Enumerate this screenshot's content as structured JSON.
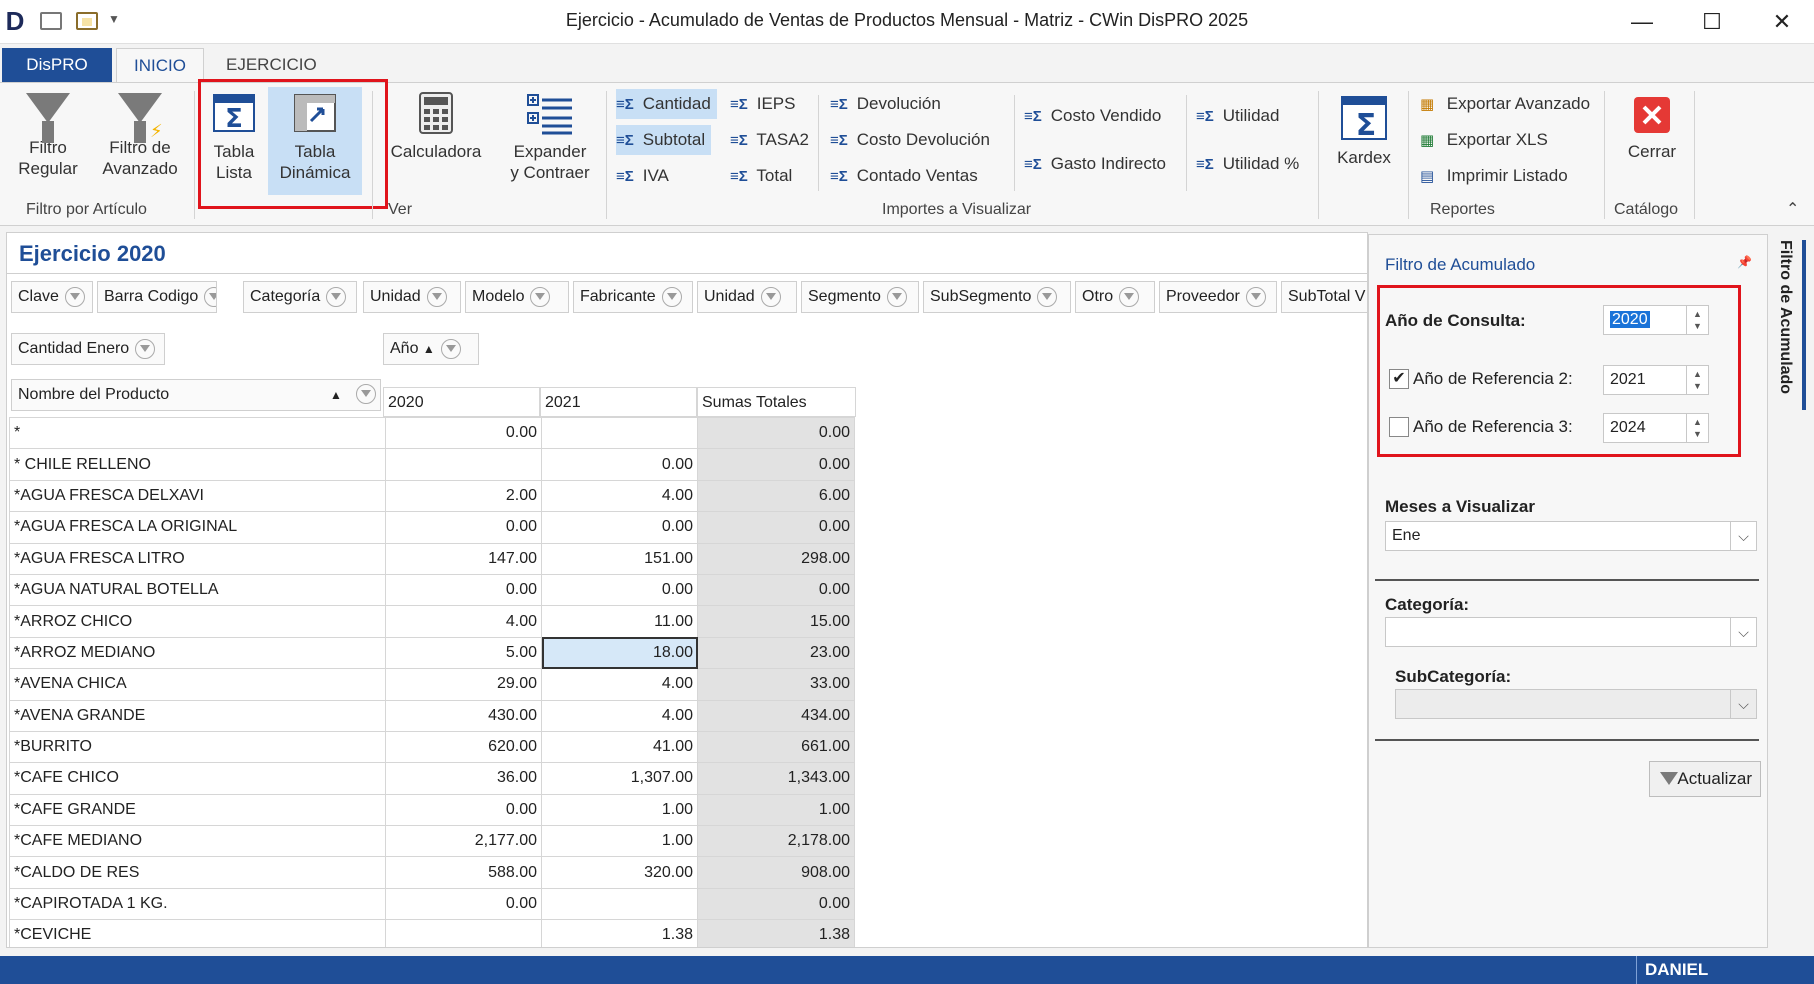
{
  "window": {
    "title": "Ejercicio - Acumulado de Ventas de Productos Mensual - Matriz - CWin DisPRO 2025",
    "logo": "D",
    "min": "—",
    "max": "☐",
    "close": "✕"
  },
  "tabs": [
    "DisPRO",
    "INICIO",
    "EJERCICIO"
  ],
  "ribbon": {
    "filtro_regular": [
      "Filtro",
      "Regular"
    ],
    "filtro_avanzado": [
      "Filtro de",
      "Avanzado"
    ],
    "group_filtro": "Filtro por Artículo",
    "tabla_lista": [
      "Tabla",
      "Lista"
    ],
    "tabla_dinamica": [
      "Tabla",
      "Dinámica"
    ],
    "calculadora": "Calculadora",
    "expander": [
      "Expander",
      "y Contraer"
    ],
    "group_ver": "Ver",
    "importes": {
      "col1": [
        "Cantidad",
        "Subtotal",
        "IVA"
      ],
      "col2": [
        "IEPS",
        "TASA2",
        "Total"
      ],
      "col3": [
        "Devolución",
        "Costo Devolución",
        "Contado Ventas"
      ],
      "col4": [
        "Costo Vendido",
        "Gasto Indirecto"
      ],
      "col5": [
        "Utilidad",
        "Utilidad %"
      ]
    },
    "group_importes": "Importes a Visualizar",
    "kardex": "Kardex",
    "reportes": [
      "Exportar Avanzado",
      "Exportar XLS",
      "Imprimir Listado"
    ],
    "group_reportes": "Reportes",
    "cerrar": "Cerrar",
    "group_catalogo": "Catálogo"
  },
  "main": {
    "title": "Ejercicio 2020",
    "fields": [
      "Clave",
      "Barra Codigo",
      "Categoría",
      "Unidad",
      "Modelo",
      "Fabricante",
      "Unidad",
      "Segmento",
      "SubSegmento",
      "Otro",
      "Proveedor",
      "SubTotal V"
    ],
    "data_field": "Cantidad Enero",
    "column_field": "Año",
    "row_field": "Nombre del Producto",
    "columns": [
      "2020",
      "2021",
      "Sumas Totales"
    ],
    "rows": [
      [
        "*",
        "0.00",
        "",
        "0.00"
      ],
      [
        "* CHILE RELLENO",
        "",
        "0.00",
        "0.00"
      ],
      [
        "*AGUA FRESCA DELXAVI",
        "2.00",
        "4.00",
        "6.00"
      ],
      [
        "*AGUA FRESCA LA ORIGINAL",
        "0.00",
        "0.00",
        "0.00"
      ],
      [
        "*AGUA FRESCA LITRO",
        "147.00",
        "151.00",
        "298.00"
      ],
      [
        "*AGUA NATURAL BOTELLA",
        "0.00",
        "0.00",
        "0.00"
      ],
      [
        "*ARROZ CHICO",
        "4.00",
        "11.00",
        "15.00"
      ],
      [
        "*ARROZ MEDIANO",
        "5.00",
        "18.00",
        "23.00"
      ],
      [
        "*AVENA CHICA",
        "29.00",
        "4.00",
        "33.00"
      ],
      [
        "*AVENA GRANDE",
        "430.00",
        "4.00",
        "434.00"
      ],
      [
        "*BURRITO",
        "620.00",
        "41.00",
        "661.00"
      ],
      [
        "*CAFE CHICO",
        "36.00",
        "1,307.00",
        "1,343.00"
      ],
      [
        "*CAFE GRANDE",
        "0.00",
        "1.00",
        "1.00"
      ],
      [
        "*CAFE MEDIANO",
        "2,177.00",
        "1.00",
        "2,178.00"
      ],
      [
        "*CALDO DE RES",
        "588.00",
        "320.00",
        "908.00"
      ],
      [
        "*CAPIROTADA 1 KG.",
        "0.00",
        "",
        "0.00"
      ],
      [
        "*CEVICHE",
        "",
        "1.38",
        "1.38"
      ]
    ]
  },
  "panel": {
    "title": "Filtro de Acumulado",
    "anio_consulta_label": "Año de Consulta:",
    "anio_consulta": "2020",
    "ref2_label": "Año de Referencia 2:",
    "ref2_value": "2021",
    "ref2_checked": "✔",
    "ref3_label": "Año de Referencia 3:",
    "ref3_value": "2024",
    "meses_label": "Meses a Visualizar",
    "meses_value": "Ene",
    "categoria_label": "Categoría:",
    "categoria_value": "",
    "subcategoria_label": "SubCategoría:",
    "subcategoria_value": "",
    "actualizar": "Actualizar",
    "side_tab": "Filtro de Acumulado"
  },
  "status": {
    "user": "DANIEL"
  },
  "colors": {
    "accent": "#1f4e97",
    "highlight": "#c8dff5",
    "red_box": "#e0141c"
  }
}
